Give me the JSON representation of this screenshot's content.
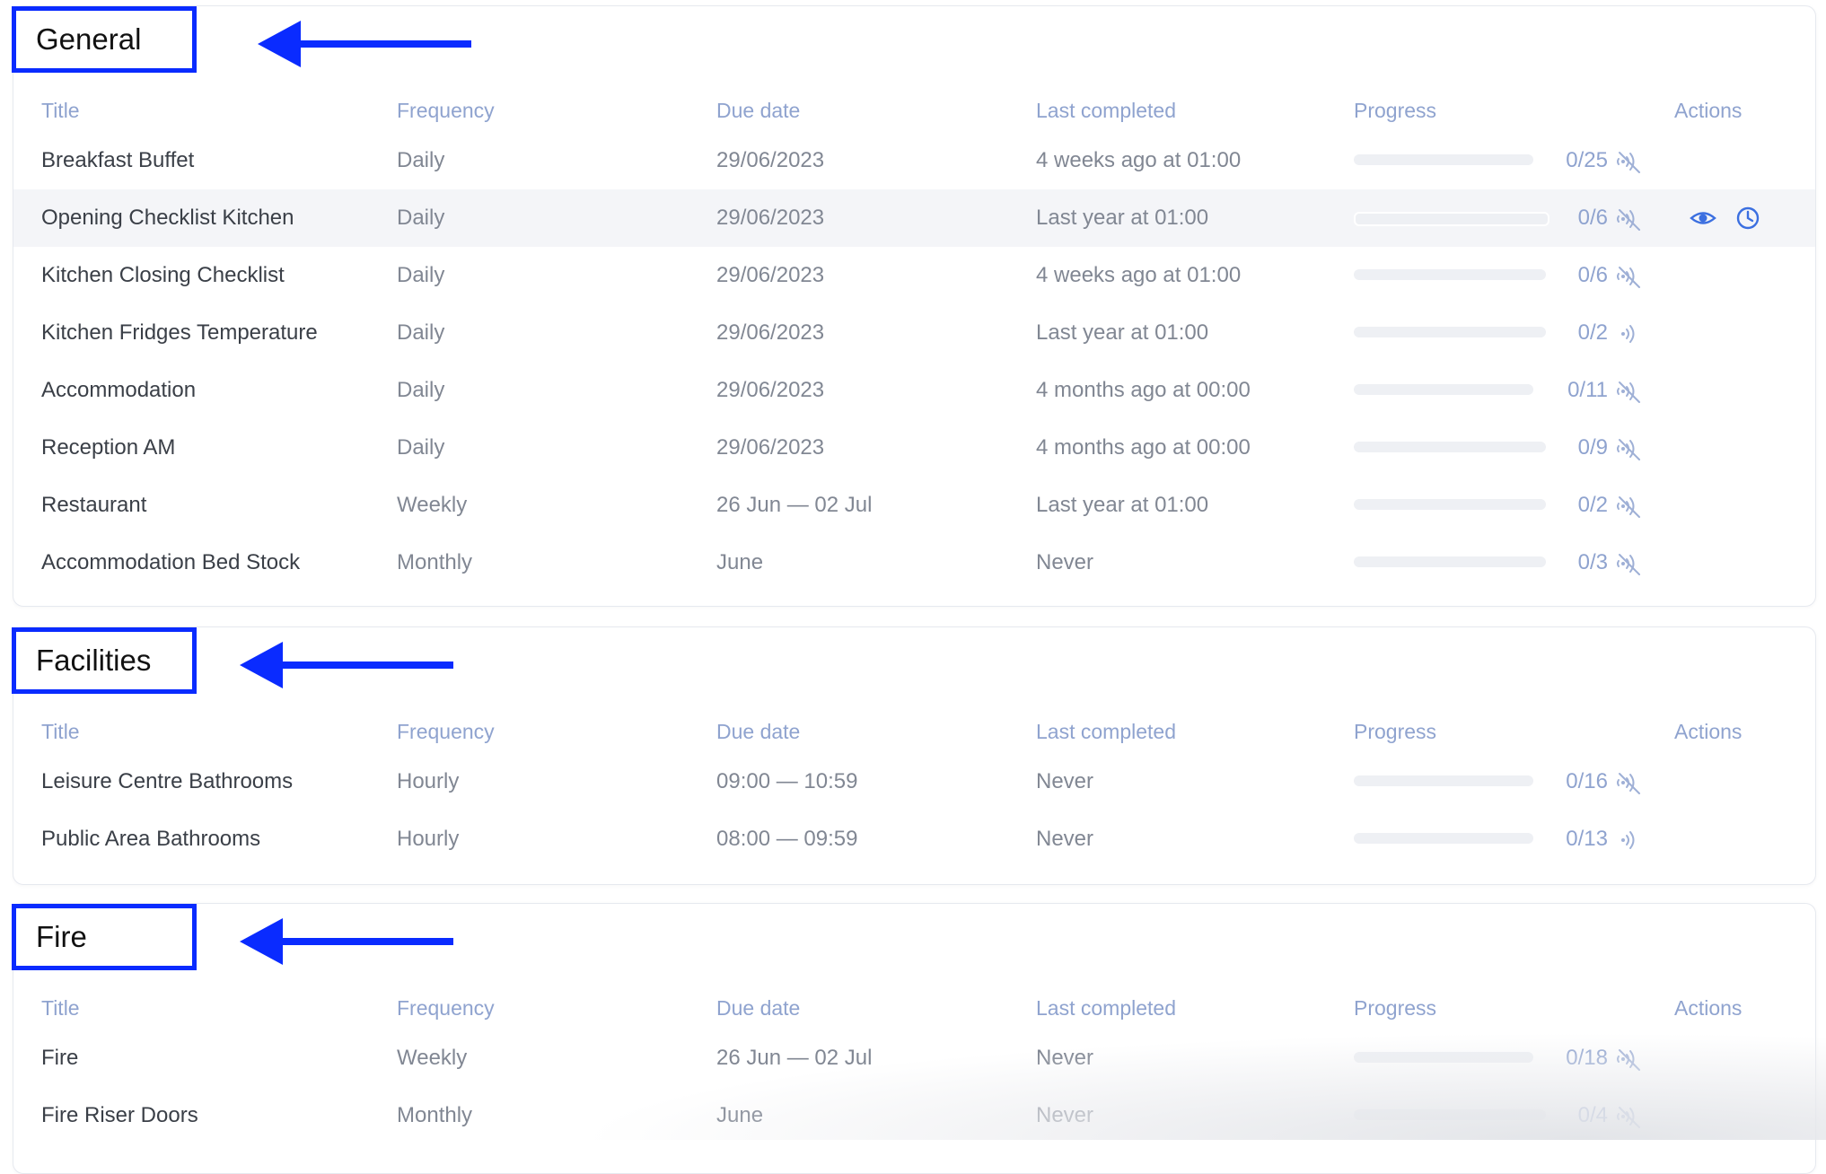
{
  "columns": {
    "title": "Title",
    "frequency": "Frequency",
    "due_date": "Due date",
    "last_completed": "Last completed",
    "progress": "Progress",
    "actions": "Actions"
  },
  "colors": {
    "annotation": "#0a2bff",
    "header_text": "#8fa3cf",
    "action_icon": "#3b6fe0"
  },
  "sections": [
    {
      "name": "General",
      "rows": [
        {
          "title": "Breakfast Buffet",
          "frequency": "Daily",
          "due": "29/06/2023",
          "last": "4 weeks ago at 01:00",
          "progress": "0/25",
          "fraction": 0,
          "signal": "sensor-off-icon"
        },
        {
          "title": "Opening Checklist Kitchen",
          "frequency": "Daily",
          "due": "29/06/2023",
          "last": "Last year at 01:00",
          "progress": "0/6",
          "fraction": 0,
          "signal": "sensor-off-icon",
          "highlight": true,
          "actions": [
            "eye-icon",
            "clock-icon"
          ]
        },
        {
          "title": "Kitchen Closing Checklist",
          "frequency": "Daily",
          "due": "29/06/2023",
          "last": "4 weeks ago at 01:00",
          "progress": "0/6",
          "fraction": 0,
          "signal": "sensor-off-icon"
        },
        {
          "title": "Kitchen Fridges Temperature",
          "frequency": "Daily",
          "due": "29/06/2023",
          "last": "Last year at 01:00",
          "progress": "0/2",
          "fraction": 0,
          "signal": "sensor-on-icon"
        },
        {
          "title": "Accommodation",
          "frequency": "Daily",
          "due": "29/06/2023",
          "last": "4 months ago at 00:00",
          "progress": "0/11",
          "fraction": 0,
          "signal": "sensor-off-icon"
        },
        {
          "title": "Reception AM",
          "frequency": "Daily",
          "due": "29/06/2023",
          "last": "4 months ago at 00:00",
          "progress": "0/9",
          "fraction": 0,
          "signal": "sensor-off-icon"
        },
        {
          "title": "Restaurant",
          "frequency": "Weekly",
          "due": "26 Jun — 02 Jul",
          "last": "Last year at 01:00",
          "progress": "0/2",
          "fraction": 0,
          "signal": "sensor-off-icon"
        },
        {
          "title": "Accommodation Bed Stock",
          "frequency": "Monthly",
          "due": "June",
          "last": "Never",
          "progress": "0/3",
          "fraction": 0,
          "signal": "sensor-off-icon"
        }
      ]
    },
    {
      "name": "Facilities",
      "rows": [
        {
          "title": "Leisure Centre Bathrooms",
          "frequency": "Hourly",
          "due": "09:00 — 10:59",
          "last": "Never",
          "progress": "0/16",
          "fraction": 0,
          "signal": "sensor-off-icon"
        },
        {
          "title": "Public Area Bathrooms",
          "frequency": "Hourly",
          "due": "08:00 — 09:59",
          "last": "Never",
          "progress": "0/13",
          "fraction": 0,
          "signal": "sensor-on-icon"
        }
      ]
    },
    {
      "name": "Fire",
      "rows": [
        {
          "title": "Fire",
          "frequency": "Weekly",
          "due": "26 Jun — 02 Jul",
          "last": "Never",
          "progress": "0/18",
          "fraction": 0,
          "signal": "sensor-off-icon"
        },
        {
          "title": "Fire Riser Doors",
          "frequency": "Monthly",
          "due": "June",
          "last": "Never",
          "progress": "0/4",
          "fraction": 0,
          "signal": "sensor-off-icon"
        }
      ]
    }
  ]
}
